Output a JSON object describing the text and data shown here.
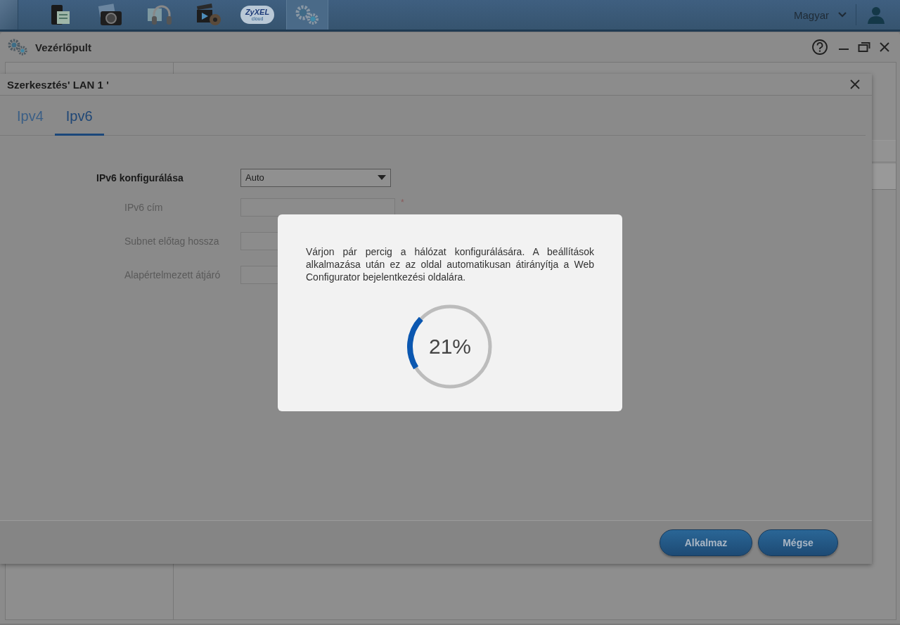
{
  "top_bar": {
    "apps": [
      {
        "kind": "storage",
        "selected": false
      },
      {
        "kind": "photo",
        "selected": false
      },
      {
        "kind": "music",
        "selected": false
      },
      {
        "kind": "video",
        "selected": false
      },
      {
        "kind": "cloud",
        "selected": false,
        "logo_text": "ZyXEL",
        "logo_subtext": "cloud"
      },
      {
        "kind": "settings",
        "selected": true
      }
    ],
    "language": "Magyar"
  },
  "window": {
    "title": "Vezérlőpult"
  },
  "dialog": {
    "title": "Szerkesztés' LAN 1 '",
    "tabs": [
      {
        "label": "Ipv4",
        "selected": false
      },
      {
        "label": "Ipv6",
        "selected": true
      }
    ],
    "fields": [
      {
        "kind": "select",
        "label": "IPv6 konfigurálása",
        "value": "Auto",
        "disabled": false,
        "children": [
          {
            "kind": "text",
            "label": "IPv6 cím",
            "disabled": true,
            "required": true
          },
          {
            "kind": "text",
            "label": "Subnet előtag hossza",
            "disabled": true
          },
          {
            "kind": "text",
            "label": "Alapértelmezett átjáró",
            "disabled": true
          }
        ]
      }
    ],
    "required_mark": "*",
    "buttons": [
      "Alkalmaz",
      "Mégse"
    ]
  },
  "progress_modal": {
    "message": "Várjon pár percig a hálózat konfigurálására. A beállítások alkalmazása után ez az oldal automatikusan átirányítja a Web Configurator bejelentkezési oldalára.",
    "level": 0.21,
    "reading": "21%"
  }
}
